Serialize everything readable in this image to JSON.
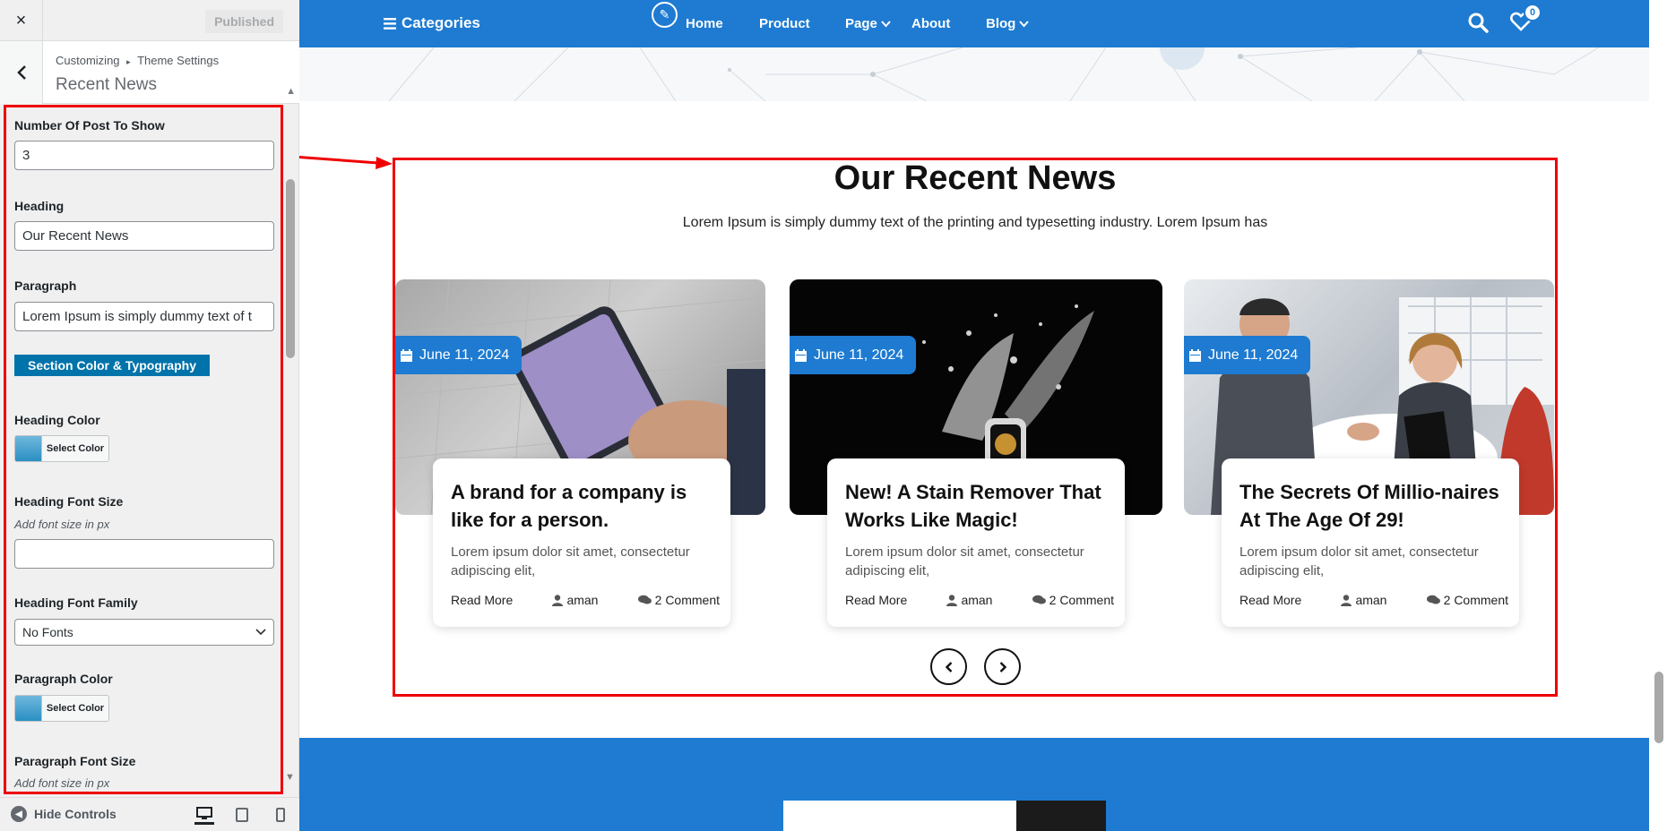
{
  "customizer": {
    "close_label": "×",
    "published_label": "Published",
    "breadcrumb_root": "Customizing",
    "breadcrumb_sep": "▸",
    "breadcrumb_section": "Theme Settings",
    "panel_title": "Recent News",
    "fields": {
      "num_posts_label": "Number Of Post To Show",
      "num_posts_value": "3",
      "heading_label": "Heading",
      "heading_value": "Our Recent News",
      "paragraph_label": "Paragraph",
      "paragraph_value": "Lorem Ipsum is simply dummy text of t",
      "section_button": "Section Color & Typography",
      "heading_color_label": "Heading Color",
      "select_color": "Select Color",
      "heading_font_size_label": "Heading Font Size",
      "font_size_desc": "Add font size in px",
      "heading_font_family_label": "Heading Font Family",
      "heading_font_family_value": "No Fonts",
      "paragraph_color_label": "Paragraph Color",
      "paragraph_font_size_label": "Paragraph Font Size"
    },
    "footer": {
      "hide_controls": "Hide Controls"
    }
  },
  "site": {
    "nav": {
      "categories": "Categories",
      "items": [
        "Home",
        "Product",
        "Page",
        "About",
        "Blog"
      ],
      "cart_count": "0"
    },
    "section": {
      "heading": "Our Recent News",
      "paragraph": "Lorem Ipsum is simply dummy text of the printing and typesetting industry. Lorem Ipsum has"
    },
    "cards": [
      {
        "date": "June 11, 2024",
        "title": "A brand for a company is like for a person.",
        "text": "Lorem ipsum dolor sit amet, consectetur adipiscing elit,",
        "read_more": "Read More",
        "author": "aman",
        "comments": "2 Comment"
      },
      {
        "date": "June 11, 2024",
        "title": "New! A Stain Remover That Works Like Magic!",
        "text": "Lorem ipsum dolor sit amet, consectetur adipiscing elit,",
        "read_more": "Read More",
        "author": "aman",
        "comments": "2 Comment"
      },
      {
        "date": "June 11, 2024",
        "title": "The Secrets Of Millio-naires At The Age Of 29!",
        "text": "Lorem ipsum dolor sit amet, consectetur adipiscing elit,",
        "read_more": "Read More",
        "author": "aman",
        "comments": "2 Comment"
      }
    ]
  }
}
